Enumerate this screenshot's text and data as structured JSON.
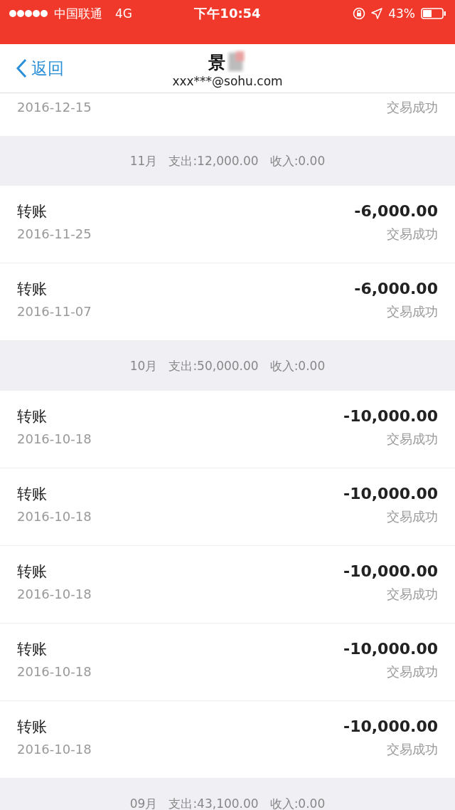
{
  "status_bar": {
    "carrier": "中国联通",
    "network": "4G",
    "time": "下午10:54",
    "battery": "43%"
  },
  "nav": {
    "back": "返回",
    "title": "景",
    "subtitle": "xxx***@sohu.com"
  },
  "items": [
    {
      "kind": "partial",
      "date": "2016-12-15",
      "status": "交易成功"
    },
    {
      "kind": "header",
      "month": "11月",
      "expense": "支出:12,000.00",
      "income": "收入:0.00"
    },
    {
      "kind": "row",
      "name": "转账",
      "amount": "-6,000.00",
      "date": "2016-11-25",
      "status": "交易成功"
    },
    {
      "kind": "row",
      "name": "转账",
      "amount": "-6,000.00",
      "date": "2016-11-07",
      "status": "交易成功"
    },
    {
      "kind": "header",
      "month": "10月",
      "expense": "支出:50,000.00",
      "income": "收入:0.00"
    },
    {
      "kind": "row",
      "name": "转账",
      "amount": "-10,000.00",
      "date": "2016-10-18",
      "status": "交易成功"
    },
    {
      "kind": "row",
      "name": "转账",
      "amount": "-10,000.00",
      "date": "2016-10-18",
      "status": "交易成功"
    },
    {
      "kind": "row",
      "name": "转账",
      "amount": "-10,000.00",
      "date": "2016-10-18",
      "status": "交易成功"
    },
    {
      "kind": "row",
      "name": "转账",
      "amount": "-10,000.00",
      "date": "2016-10-18",
      "status": "交易成功"
    },
    {
      "kind": "row",
      "name": "转账",
      "amount": "-10,000.00",
      "date": "2016-10-18",
      "status": "交易成功"
    },
    {
      "kind": "header",
      "month": "09月",
      "expense": "支出:43,100.00",
      "income": "收入:0.00"
    }
  ]
}
